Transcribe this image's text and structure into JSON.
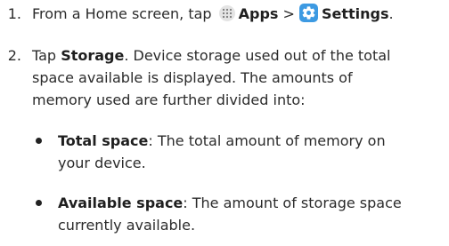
{
  "steps": [
    {
      "number": "1.",
      "prefix": "From a Home screen, tap",
      "apps_label": "Apps",
      "separator": ">",
      "settings_label": "Settings",
      "suffix": "."
    },
    {
      "number": "2.",
      "tap": "Tap",
      "storage_label": "Storage",
      "line1_rest": ". Device storage used out of the total",
      "line2": "space available is displayed. The amounts of",
      "line3": "memory used are further divided into:"
    }
  ],
  "bullets": [
    {
      "term": "Total space",
      "line1_rest": ": The total amount of memory on",
      "line2": "your device."
    },
    {
      "term": "Available space",
      "line1_rest": ": The amount of storage space",
      "line2": "currently available."
    }
  ],
  "icons": {
    "apps": "apps-grid-icon",
    "settings": "settings-gear-icon"
  },
  "colors": {
    "settings_icon_bg": "#3d9ae2",
    "apps_icon_bg": "#e4e4e4"
  }
}
